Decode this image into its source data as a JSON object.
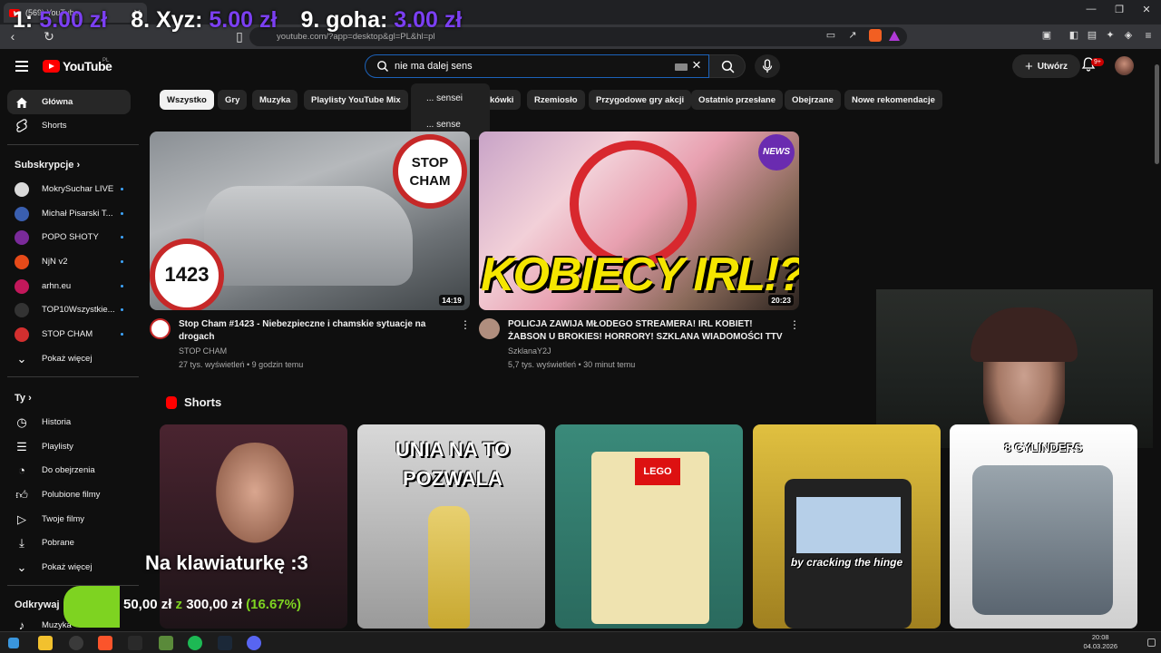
{
  "browser": {
    "tab_title": "(569) YouTube",
    "url": "youtube.com/?app=desktop&gl=PL&hl=pl",
    "window_min": "—",
    "window_max": "❐",
    "window_close": "✕"
  },
  "overlay_top": {
    "entries": [
      {
        "label": "1:",
        "amount": "5.00 zł"
      },
      {
        "label": "8. Xyz:",
        "amount": "5.00 zł"
      },
      {
        "label": "9. goha:",
        "amount": "3.00 zł"
      }
    ]
  },
  "header": {
    "logo_text": "YouTube",
    "logo_region": "PL",
    "search_value": "nie ma dalej sens",
    "create_label": "Utwórz",
    "notification_badge": "9+"
  },
  "suggestions": [
    "... sensei",
    "... sense"
  ],
  "chips": [
    "Wszystko",
    "Gry",
    "Muzyka",
    "Playlisty YouTube Mix",
    "kówki",
    "Rzemiosło",
    "Przygodowe gry akcji",
    "Ostatnio przesłane",
    "Obejrzane",
    "Nowe rekomendacje"
  ],
  "sidebar": {
    "main": [
      {
        "label": "Główna",
        "icon": "home-icon"
      },
      {
        "label": "Shorts",
        "icon": "shorts-icon"
      }
    ],
    "subs_heading": "Subskrypcje",
    "subs": [
      {
        "label": "MokrySuchar LIVE",
        "color": "#d9d9d9"
      },
      {
        "label": "Michał Pisarski T...",
        "color": "#3a5fb0"
      },
      {
        "label": "POPO SHOTY",
        "color": "#7a2a9a"
      },
      {
        "label": "NjN v2",
        "color": "#e64a19"
      },
      {
        "label": "arhn.eu",
        "color": "#c2185b"
      },
      {
        "label": "TOP10Wszystkie...",
        "color": "#333333"
      },
      {
        "label": "STOP CHAM",
        "color": "#d32f2f"
      }
    ],
    "subs_more": "Pokaż więcej",
    "you_heading": "Ty",
    "you": [
      {
        "label": "Historia",
        "icon": "history-icon"
      },
      {
        "label": "Playlisty",
        "icon": "playlist-icon"
      },
      {
        "label": "Do obejrzenia",
        "icon": "watch-later-icon"
      },
      {
        "label": "Polubione filmy",
        "icon": "like-icon"
      },
      {
        "label": "Twoje filmy",
        "icon": "your-videos-icon"
      },
      {
        "label": "Pobrane",
        "icon": "download-icon"
      }
    ],
    "you_more": "Pokaż więcej",
    "explore_heading": "Odkrywaj",
    "explore_first": "Muzyka"
  },
  "videos": [
    {
      "title": "Stop Cham #1423 - Niebezpieczne i chamskie sytuacje na drogach",
      "channel": "STOP CHAM",
      "meta": "27 tys. wyświetleń • 9 godzin temu",
      "duration": "14:19",
      "thumb_badge": "STOP CHAM",
      "thumb_number": "1423"
    },
    {
      "title": "POLICJA ZAWIJA MŁODEGO STREAMERA! IRL KOBIET! ŻABSON U BROKIES! HORRORY! SZKLANA WIADOMOŚCI TTV",
      "channel": "SzklanaY2J",
      "meta": "5,7 tys. wyświetleń • 30 minut temu",
      "duration": "20:23",
      "thumb_text": "KOBIECY IRL!?",
      "thumb_badge": "NEWS"
    }
  ],
  "shorts": {
    "heading": "Shorts",
    "items": [
      {
        "caption": "",
        "colors": [
          "#4a2430",
          "#1e1418"
        ]
      },
      {
        "caption": "UNIA NA TO POZWALA",
        "colors": [
          "#d8d8d8",
          "#9a9a9a"
        ]
      },
      {
        "caption": "LEGO",
        "colors": [
          "#3a8a7a",
          "#2a6a5e"
        ]
      },
      {
        "caption": "by cracking the hinge",
        "colors": [
          "#e0c040",
          "#a08020"
        ]
      },
      {
        "caption": "8 CYLINDERS",
        "colors": [
          "#ffffff",
          "#cfcfcf"
        ]
      }
    ]
  },
  "overlay_bottom": {
    "text": "Na klawiaturkę :3",
    "goal_text_current": "50,00 zł",
    "goal_text_z": "z",
    "goal_text_total": "300,00 zł",
    "goal_percent_text": "(16.67%)",
    "goal_fraction": 0.1667
  },
  "taskbar": {
    "time": "20:08",
    "date": "04.03.2026"
  }
}
